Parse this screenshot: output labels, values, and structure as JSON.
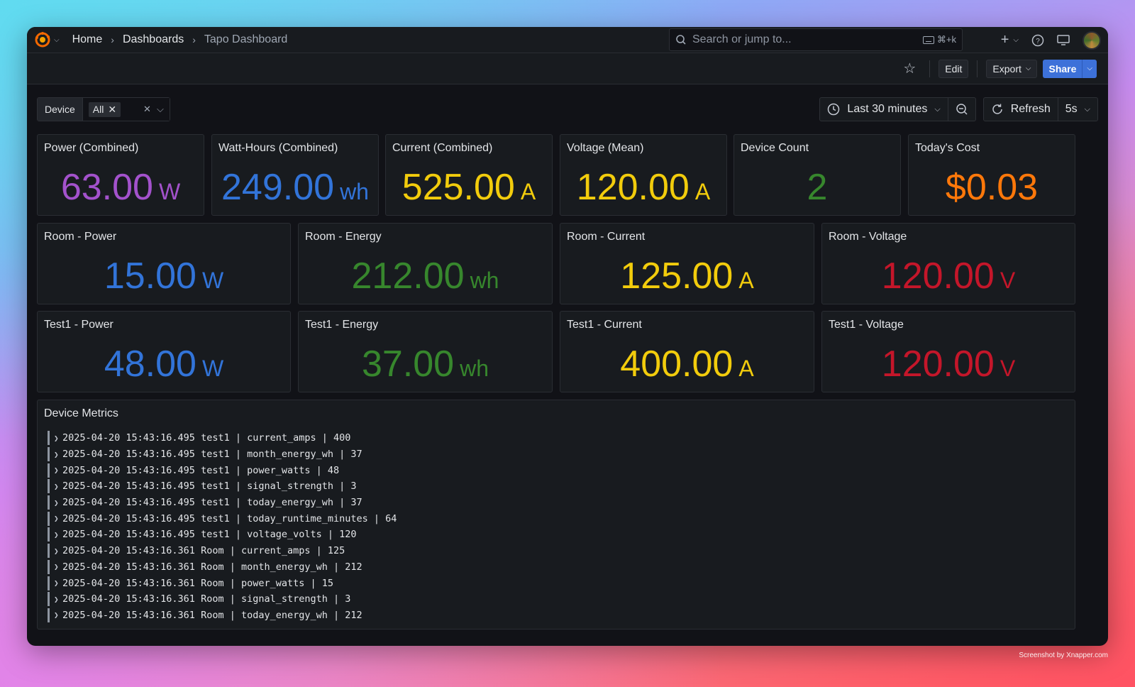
{
  "nav": {
    "breadcrumb": [
      "Home",
      "Dashboards",
      "Tapo Dashboard"
    ],
    "search_placeholder": "Search or jump to...",
    "search_shortcut": "⌘+k"
  },
  "toolbar": {
    "edit_label": "Edit",
    "export_label": "Export",
    "share_label": "Share"
  },
  "variables": {
    "device_label": "Device",
    "device_value": "All"
  },
  "time": {
    "range_label": "Last 30 minutes",
    "refresh_label": "Refresh",
    "refresh_interval": "5s"
  },
  "colors": {
    "purple": "#a352cc",
    "blue": "#3274d9",
    "yellow": "#f2cc0c",
    "green": "#37872d",
    "orange": "#ff780a",
    "red": "#c4162a",
    "primary_button": "#3d71d9"
  },
  "stats_row1": [
    {
      "title": "Power (Combined)",
      "value": "63.00",
      "unit": "W",
      "color": "purple"
    },
    {
      "title": "Watt-Hours (Combined)",
      "value": "249.00",
      "unit": "wh",
      "color": "blue"
    },
    {
      "title": "Current (Combined)",
      "value": "525.00",
      "unit": "A",
      "color": "yellow"
    },
    {
      "title": "Voltage (Mean)",
      "value": "120.00",
      "unit": "A",
      "color": "yellow"
    },
    {
      "title": "Device Count",
      "value": "2",
      "unit": "",
      "color": "green"
    },
    {
      "title": "Today's Cost",
      "value": "$0.03",
      "unit": "",
      "color": "orange"
    }
  ],
  "stats_row2": [
    {
      "title": "Room - Power",
      "value": "15.00",
      "unit": "W",
      "color": "blue"
    },
    {
      "title": "Room - Energy",
      "value": "212.00",
      "unit": "wh",
      "color": "green"
    },
    {
      "title": "Room - Current",
      "value": "125.00",
      "unit": "A",
      "color": "yellow"
    },
    {
      "title": "Room - Voltage",
      "value": "120.00",
      "unit": "V",
      "color": "red"
    }
  ],
  "stats_row3": [
    {
      "title": "Test1 - Power",
      "value": "48.00",
      "unit": "W",
      "color": "blue"
    },
    {
      "title": "Test1 - Energy",
      "value": "37.00",
      "unit": "wh",
      "color": "green"
    },
    {
      "title": "Test1 - Current",
      "value": "400.00",
      "unit": "A",
      "color": "yellow"
    },
    {
      "title": "Test1 - Voltage",
      "value": "120.00",
      "unit": "V",
      "color": "red"
    }
  ],
  "device_metrics": {
    "title": "Device Metrics",
    "lines": [
      "2025-04-20 15:43:16.495 test1 | current_amps | 400",
      "2025-04-20 15:43:16.495 test1 | month_energy_wh | 37",
      "2025-04-20 15:43:16.495 test1 | power_watts | 48",
      "2025-04-20 15:43:16.495 test1 | signal_strength | 3",
      "2025-04-20 15:43:16.495 test1 | today_energy_wh | 37",
      "2025-04-20 15:43:16.495 test1 | today_runtime_minutes | 64",
      "2025-04-20 15:43:16.495 test1 | voltage_volts | 120",
      "2025-04-20 15:43:16.361 Room | current_amps | 125",
      "2025-04-20 15:43:16.361 Room | month_energy_wh | 212",
      "2025-04-20 15:43:16.361 Room | power_watts | 15",
      "2025-04-20 15:43:16.361 Room | signal_strength | 3",
      "2025-04-20 15:43:16.361 Room | today_energy_wh | 212"
    ]
  },
  "watermark": "Screenshot by Xnapper.com"
}
